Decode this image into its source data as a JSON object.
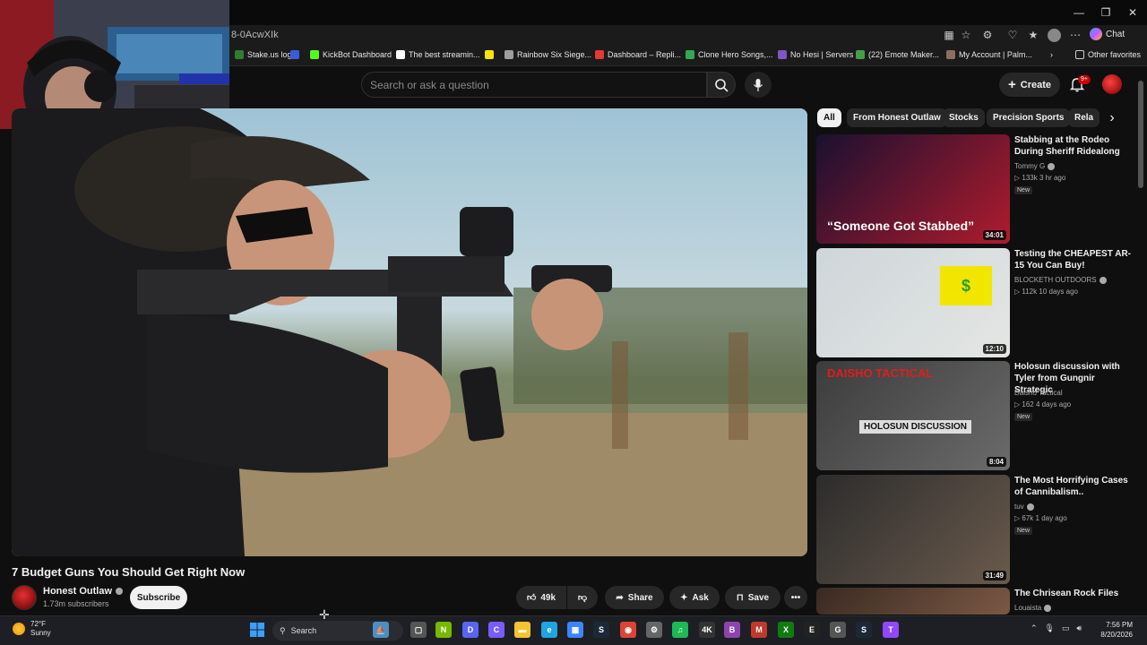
{
  "browser": {
    "url": "8-0AcwXIk",
    "chat_label": "Chat",
    "other_favorites": "Other favorites",
    "bookmarks": [
      {
        "label": "Stake.us logo",
        "color": "#2e7d32"
      },
      {
        "label": "",
        "color": "#3b5bdb"
      },
      {
        "label": "KickBot Dashboard",
        "color": "#53fc18"
      },
      {
        "label": "The best streamin...",
        "color": "#ffffff"
      },
      {
        "label": "",
        "color": "#f5e50a"
      },
      {
        "label": "Rainbow Six Siege...",
        "color": "#9e9e9e"
      },
      {
        "label": "Dashboard – Repli...",
        "color": "#e53935"
      },
      {
        "label": "Clone Hero Songs,...",
        "color": "#34a853"
      },
      {
        "label": "No Hesi | Servers",
        "color": "#7e57c2"
      },
      {
        "label": "(22) Emote Maker...",
        "color": "#43a047"
      },
      {
        "label": "My Account | Palm...",
        "color": "#8d6e63"
      }
    ]
  },
  "youtube": {
    "search_placeholder": "Search or ask a question",
    "create_label": "Create",
    "notifications_badge": "9+",
    "video": {
      "title": "7 Budget Guns You Should Get Right Now",
      "channel": "Honest Outlaw",
      "subscribers": "1.73m subscribers",
      "subscribe_label": "Subscribe",
      "likes": "49k",
      "share_label": "Share",
      "ask_label": "Ask",
      "save_label": "Save"
    },
    "chips": [
      "All",
      "From Honest Outlaw",
      "Stocks",
      "Precision Sports",
      "Rela"
    ],
    "related": [
      {
        "title": "Stabbing at the Rodeo During Sheriff Ridealong",
        "channel": "Tommy G",
        "verified": true,
        "views": "133k",
        "age": "3 hr ago",
        "new": "New",
        "duration": "34:01",
        "thumb_caption": "“Someone Got Stabbed”"
      },
      {
        "title": "Testing the CHEAPEST AR-15 You Can Buy!",
        "channel": "BLOCKETH OUTDOORS",
        "verified": true,
        "views": "112k",
        "age": "10 days ago",
        "new": "",
        "duration": "12:10",
        "thumb_caption": "$"
      },
      {
        "title": "Holosun discussion with Tyler from Gungnir Strategic",
        "channel": "Daisho Tactical",
        "verified": false,
        "views": "162",
        "age": "4 days ago",
        "new": "New",
        "duration": "8:04",
        "thumb_caption": "DAISHO TACTICAL",
        "thumb_caption2": "HOLOSUN DISCUSSION"
      },
      {
        "title": "The Most Horrifying Cases of Cannibalism..",
        "channel": "tuv",
        "verified": true,
        "views": "67k",
        "age": "1 day ago",
        "new": "New",
        "duration": "31:49",
        "thumb_caption": ""
      },
      {
        "title": "The Chrisean Rock Files",
        "channel": "Louaista",
        "verified": true,
        "views": "",
        "age": "",
        "new": "",
        "duration": "",
        "thumb_caption": ""
      }
    ]
  },
  "taskbar": {
    "temp": "72°F",
    "condition": "Sunny",
    "search_label": "Search",
    "time": "7:56 PM",
    "date": "8/20/2026"
  }
}
